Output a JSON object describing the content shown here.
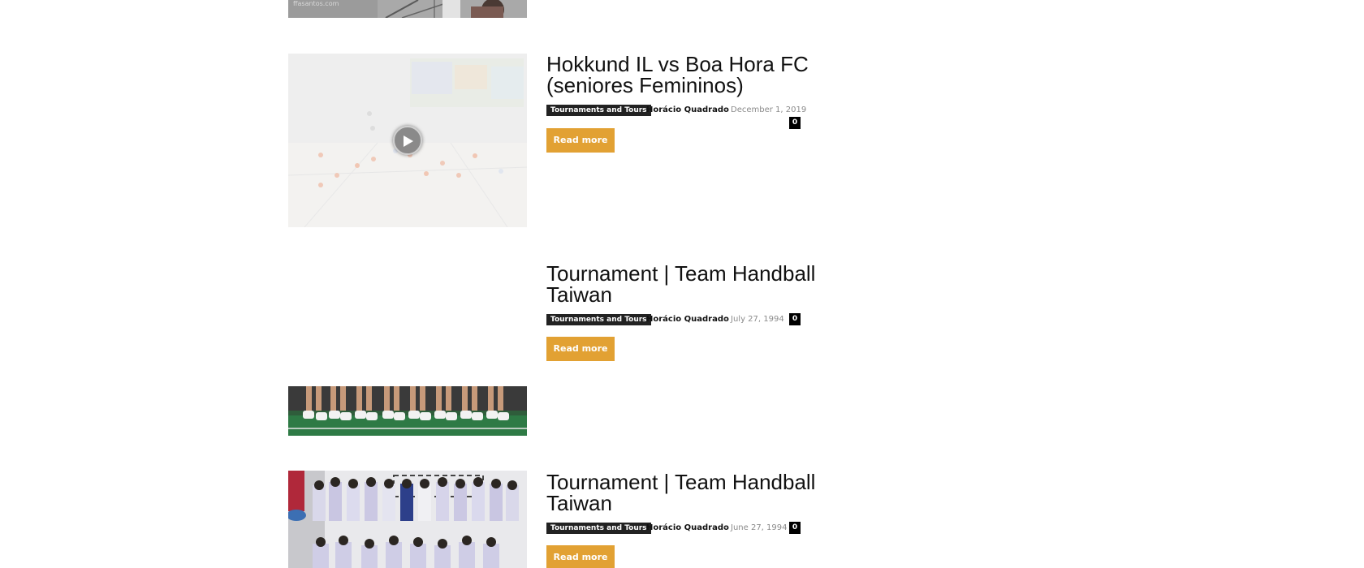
{
  "colors": {
    "accent": "#e2a133",
    "category_bg": "#222222",
    "comment_bg": "#000000",
    "title": "#111111",
    "date": "#8a8a8a"
  },
  "top_thumbnail": {
    "watermark": "ffasantos.com"
  },
  "posts": [
    {
      "title": "Hokkund IL vs Boa Hora FC (seniores Femininos)",
      "category": "Tournaments and Tours",
      "author": "Horácio Quadrado",
      "separator": "-",
      "date": "December 1, 2019",
      "comments": "0",
      "read_more": "Read more",
      "thumbnail_icon": "play-icon"
    },
    {
      "title": "Tournament | Team Handball Taiwan",
      "category": "Tournaments and Tours",
      "author": "Horácio Quadrado",
      "separator": "-",
      "date": "July 27, 1994",
      "comments": "0",
      "read_more": "Read more"
    },
    {
      "title": "Tournament | Team Handball Taiwan",
      "category": "Tournaments and Tours",
      "author": "Horácio Quadrado",
      "separator": "-",
      "date": "June 27, 1994",
      "comments": "0",
      "read_more": "Read more"
    }
  ]
}
